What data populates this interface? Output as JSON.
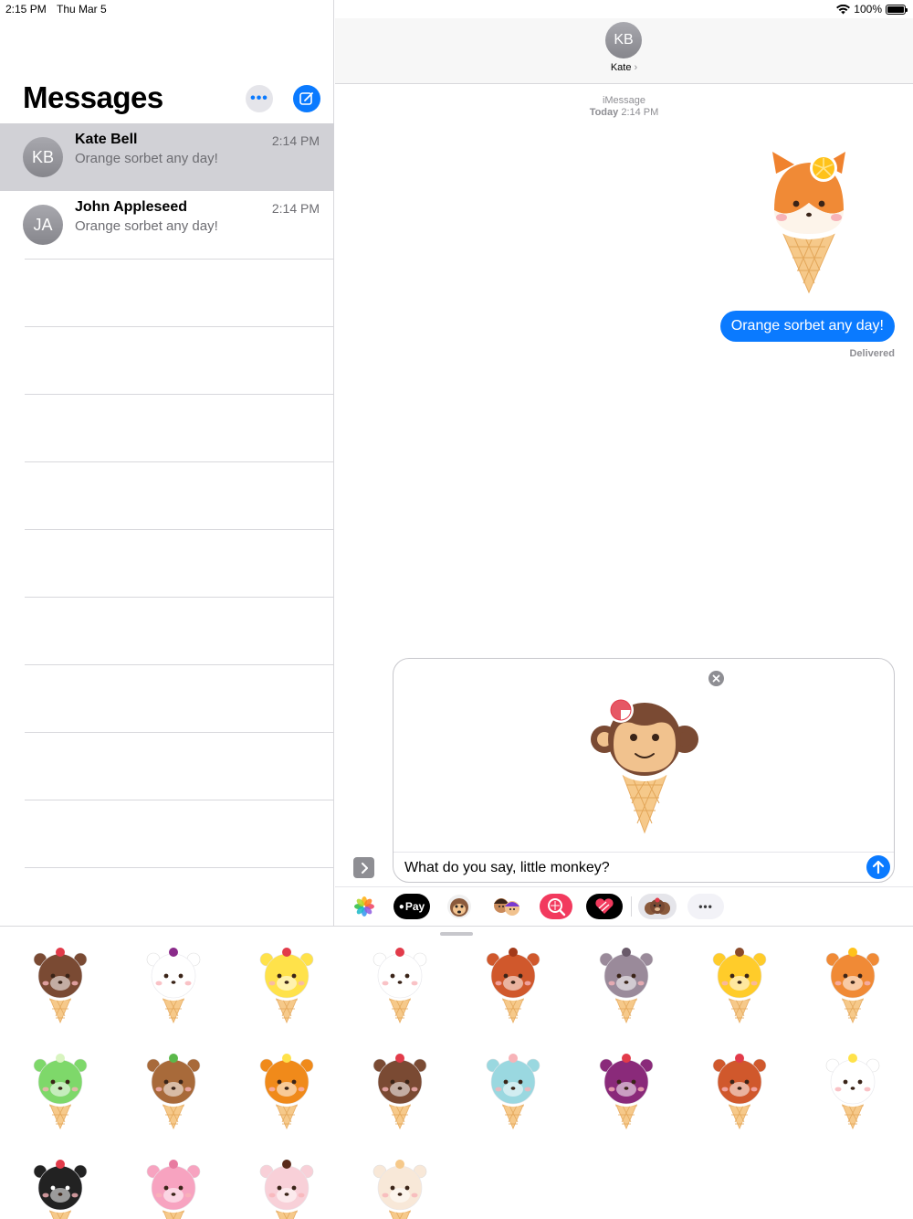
{
  "status_bar": {
    "time": "2:15 PM",
    "date": "Thu Mar 5",
    "battery": "100%"
  },
  "sidebar": {
    "title": "Messages",
    "conversations": [
      {
        "initials": "KB",
        "name": "Kate Bell",
        "preview": "Orange sorbet any day!",
        "time": "2:14 PM",
        "selected": true
      },
      {
        "initials": "JA",
        "name": "John Appleseed",
        "preview": "Orange sorbet any day!",
        "time": "2:14 PM",
        "selected": false
      }
    ]
  },
  "conversation": {
    "contact_initials": "KB",
    "contact_name": "Kate",
    "service": "iMessage",
    "timestamp_day": "Today",
    "timestamp_time": "2:14 PM",
    "sent_sticker": "fox-ice-cream-sticker",
    "message": "Orange sorbet any day!",
    "status": "Delivered"
  },
  "compose": {
    "attached_sticker": "monkey-ice-cream-sticker",
    "text": "What do you say, little monkey?"
  },
  "app_drawer": {
    "apps": [
      "photos-icon",
      "Pay",
      "animoji-icon",
      "memoji-icon",
      "search-images-icon",
      "digital-touch-icon",
      "ice-cream-stickers-icon",
      "more-apps-icon"
    ]
  },
  "sticker_tray": {
    "stickers": [
      "bear",
      "cow-with-umbrella",
      "chick",
      "cow",
      "dog",
      "donkey",
      "duckling",
      "fox",
      "frog",
      "hedgehog",
      "lion",
      "monkey",
      "mouse",
      "octopus",
      "owl",
      "panda",
      "penguin",
      "pig",
      "bunny",
      "sheep"
    ]
  },
  "colors": {
    "accent": "#0a7aff",
    "selected_row": "#d1d1d6",
    "avatar_gray": "#8e8e93",
    "cone": "#f6c98a"
  }
}
